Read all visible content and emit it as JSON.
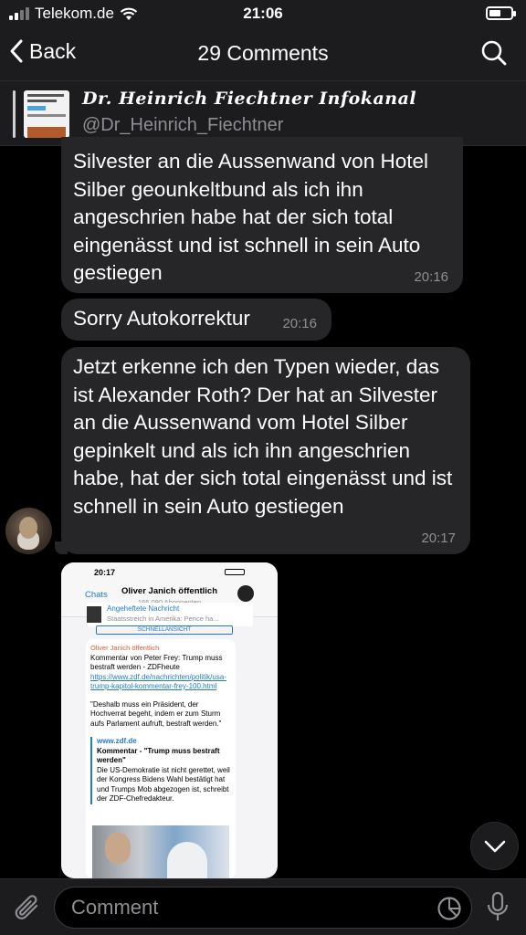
{
  "status_bar": {
    "carrier": "Telekom.de",
    "time": "21:06"
  },
  "nav": {
    "back_label": "Back",
    "title": "29 Comments"
  },
  "channel": {
    "name": "Dr. Heinrich Fiechtner Infokanal",
    "handle": "@Dr_Heinrich_Fiechtner"
  },
  "messages": [
    {
      "text": "Silvester an die Aussenwand von Hotel Silber geounkeltbund als ich ihn angeschrien habe hat der sich total eingenässt und ist schnell in sein Auto gestiegen",
      "time": "20:16"
    },
    {
      "text": "Sorry Autokorrektur",
      "time": "20:16"
    },
    {
      "text": "Jetzt erkenne ich den Typen wieder, das ist Alexander Roth? Der hat an Silvester an die Aussenwand vom Hotel Silber gepinkelt und als ich ihn angeschrien habe, hat der sich total eingenässt und ist schnell in sein Auto gestiegen",
      "time": "20:17"
    }
  ],
  "screenshot": {
    "time": "20:17",
    "back_label": "Chats",
    "channel_title": "Oliver Janich öffentlich",
    "subscribers": "166.090 Abonnenten",
    "pinned_title": "Angeheftete Nachricht",
    "pinned_text": "Staatsstreich in Amerika: Pence ha...",
    "button_text": "SCHNELLANSICHT",
    "author": "Oliver Janich öffentlich",
    "body1": "Kommentar von Peter Frey: Trump muss bestraft werden - ZDFheute",
    "link": "https://www.zdf.de/nachrichten/politik/usa-trump-kapitol-kommentar-frey-100.html",
    "quote": "\"Deshalb muss ein Präsident, der Hochverrat begeht, indem er zum Sturm aufs Parlament aufruft, bestraft werden.\"",
    "preview_site": "www.zdf.de",
    "preview_title": "Kommentar - \"Trump muss bestraft werden\"",
    "preview_desc": "Die US-Demokratie ist nicht gerettet, weil der Kongress Bidens Wahl bestätigt hat und Trumps Mob abgezogen ist, schreibt der ZDF-Chefredakteur."
  },
  "input": {
    "placeholder": "Comment"
  },
  "icons": {
    "back": "chevron-left-icon",
    "search": "search-icon",
    "attach": "paperclip-icon",
    "schedule": "schedule-icon",
    "mic": "microphone-icon",
    "scroll_down": "chevron-down-icon"
  },
  "colors": {
    "background": "#000000",
    "bar": "#1c1c1e",
    "bubble": "#262628",
    "secondary_text": "#8e8e93",
    "link": "#1e7ad6"
  }
}
